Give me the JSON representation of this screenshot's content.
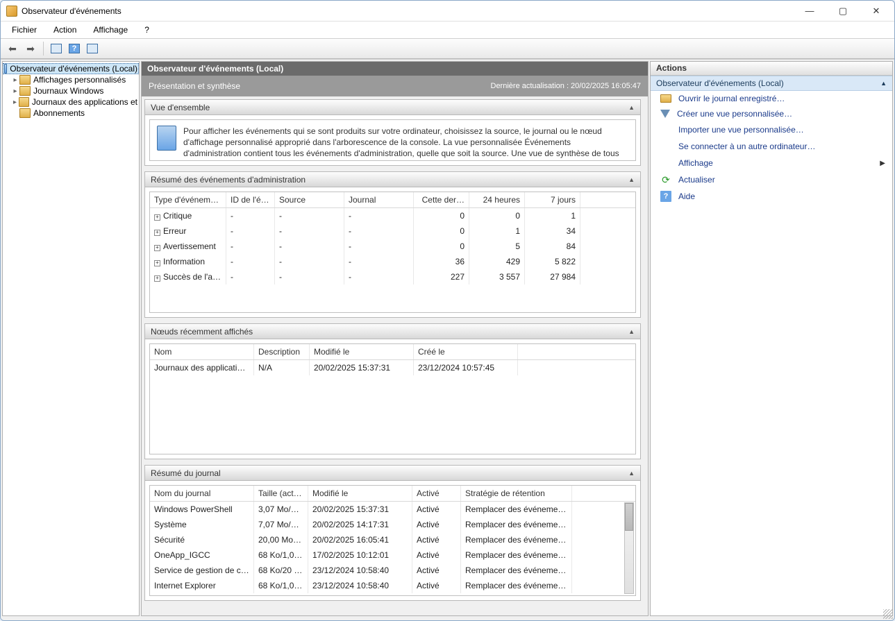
{
  "window": {
    "title": "Observateur d'événements"
  },
  "menu": {
    "file": "Fichier",
    "action": "Action",
    "view": "Affichage",
    "help": "?"
  },
  "tree": {
    "root": "Observateur d'événements (Local)",
    "items": [
      "Affichages personnalisés",
      "Journaux Windows",
      "Journaux des applications et",
      "Abonnements"
    ]
  },
  "center": {
    "header": "Observateur d'événements (Local)",
    "subtitle": "Présentation et synthèse",
    "last_refresh": "Dernière actualisation : 20/02/2025 16:05:47",
    "overview_section": "Vue d'ensemble",
    "overview_text": "Pour afficher les événements qui se sont produits sur votre ordinateur, choisissez la source, le journal ou le nœud d'affichage personnalisé approprié dans l'arborescence de la console. La vue personnalisée Événements d'administration contient tous les événements d'administration, quelle que soit la source. Une vue de synthèse de tous les journaux est affichée ci-dessous.",
    "admin_summary_section": "Résumé des événements d'administration",
    "summary_headers": {
      "type": "Type d'événem…",
      "id": "ID de l'é…",
      "source": "Source",
      "journal": "Journal",
      "hour": "Cette der…",
      "day": "24 heures",
      "week": "7 jours"
    },
    "summary_rows": [
      {
        "type": "Critique",
        "id": "-",
        "source": "-",
        "journal": "-",
        "hour": "0",
        "day": "0",
        "week": "1"
      },
      {
        "type": "Erreur",
        "id": "-",
        "source": "-",
        "journal": "-",
        "hour": "0",
        "day": "1",
        "week": "34"
      },
      {
        "type": "Avertissement",
        "id": "-",
        "source": "-",
        "journal": "-",
        "hour": "0",
        "day": "5",
        "week": "84"
      },
      {
        "type": "Information",
        "id": "-",
        "source": "-",
        "journal": "-",
        "hour": "36",
        "day": "429",
        "week": "5 822"
      },
      {
        "type": "Succès de l'a…",
        "id": "-",
        "source": "-",
        "journal": "-",
        "hour": "227",
        "day": "3 557",
        "week": "27 984"
      }
    ],
    "recent_nodes_section": "Nœuds récemment affichés",
    "recent_headers": {
      "name": "Nom",
      "desc": "Description",
      "modified": "Modifié le",
      "created": "Créé le"
    },
    "recent_rows": [
      {
        "name": "Journaux des application…",
        "desc": "N/A",
        "modified": "20/02/2025 15:37:31",
        "created": "23/12/2024 10:57:45"
      }
    ],
    "log_summary_section": "Résumé du journal",
    "log_headers": {
      "name": "Nom du journal",
      "size": "Taille (act…",
      "modified": "Modifié le",
      "enabled": "Activé",
      "retention": "Stratégie de rétention"
    },
    "log_rows": [
      {
        "name": "Windows PowerShell",
        "size": "3,07 Mo/1…",
        "modified": "20/02/2025 15:37:31",
        "enabled": "Activé",
        "retention": "Remplacer des événeme…"
      },
      {
        "name": "Système",
        "size": "7,07 Mo/2…",
        "modified": "20/02/2025 14:17:31",
        "enabled": "Activé",
        "retention": "Remplacer des événeme…"
      },
      {
        "name": "Sécurité",
        "size": "20,00 Mo/…",
        "modified": "20/02/2025 16:05:41",
        "enabled": "Activé",
        "retention": "Remplacer des événeme…"
      },
      {
        "name": "OneApp_IGCC",
        "size": "68 Ko/1,0…",
        "modified": "17/02/2025 10:12:01",
        "enabled": "Activé",
        "retention": "Remplacer des événeme…"
      },
      {
        "name": "Service de gestion de clés",
        "size": "68 Ko/20 …",
        "modified": "23/12/2024 10:58:40",
        "enabled": "Activé",
        "retention": "Remplacer des événeme…"
      },
      {
        "name": "Internet Explorer",
        "size": "68 Ko/1,0…",
        "modified": "23/12/2024 10:58:40",
        "enabled": "Activé",
        "retention": "Remplacer des événeme…"
      }
    ]
  },
  "actions": {
    "title": "Actions",
    "section": "Observateur d'événements (Local)",
    "items": [
      "Ouvrir le journal enregistré…",
      "Créer une vue personnalisée…",
      "Importer une vue personnalisée…",
      "Se connecter à un autre ordinateur…",
      "Affichage",
      "Actualiser",
      "Aide"
    ]
  }
}
